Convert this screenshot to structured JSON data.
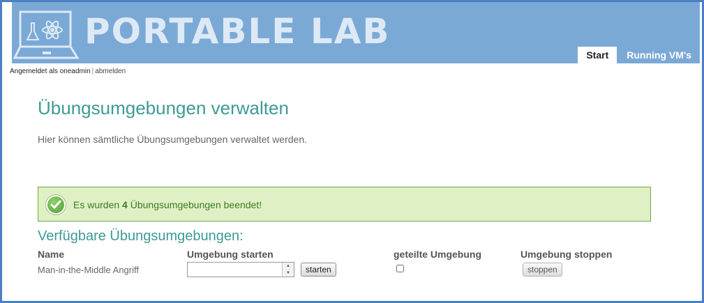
{
  "header": {
    "brand": "PORTABLE LAB",
    "tabs": [
      {
        "label": "Start",
        "active": true
      },
      {
        "label": "Running VM's",
        "active": false
      }
    ]
  },
  "user_bar": {
    "logged_in_text": "Angemeldet als oneadmin",
    "separator": "|",
    "logout_link": "abmelden"
  },
  "main": {
    "title": "Übungsumgebungen verwalten",
    "intro": "Hier können sämtliche Übungsumgebungen verwaltet werden.",
    "success": {
      "prefix": "Es wurden",
      "count": "4",
      "suffix": "Übungsumgebungen beendet!"
    },
    "section_title": "Verfügbare Übungsumgebungen:",
    "table": {
      "columns": [
        "Name",
        "Umgebung starten",
        "geteilte Umgebung",
        "Umgebung stoppen"
      ],
      "rows": [
        {
          "name": "Man-in-the-Middle Angriff",
          "start_value": "",
          "start_button": "starten",
          "shared": false,
          "stop_button": "stoppen"
        }
      ]
    }
  },
  "colors": {
    "frame_border": "#4a7fc1",
    "header_bg": "#7aa9d6",
    "title": "#3d9a95",
    "success_bg": "#dff1c4",
    "success_border": "#6ea545",
    "success_text": "#3d7a25"
  },
  "icons": {
    "logo": "laptop-atom-icon",
    "success": "checkmark-circle-icon"
  }
}
